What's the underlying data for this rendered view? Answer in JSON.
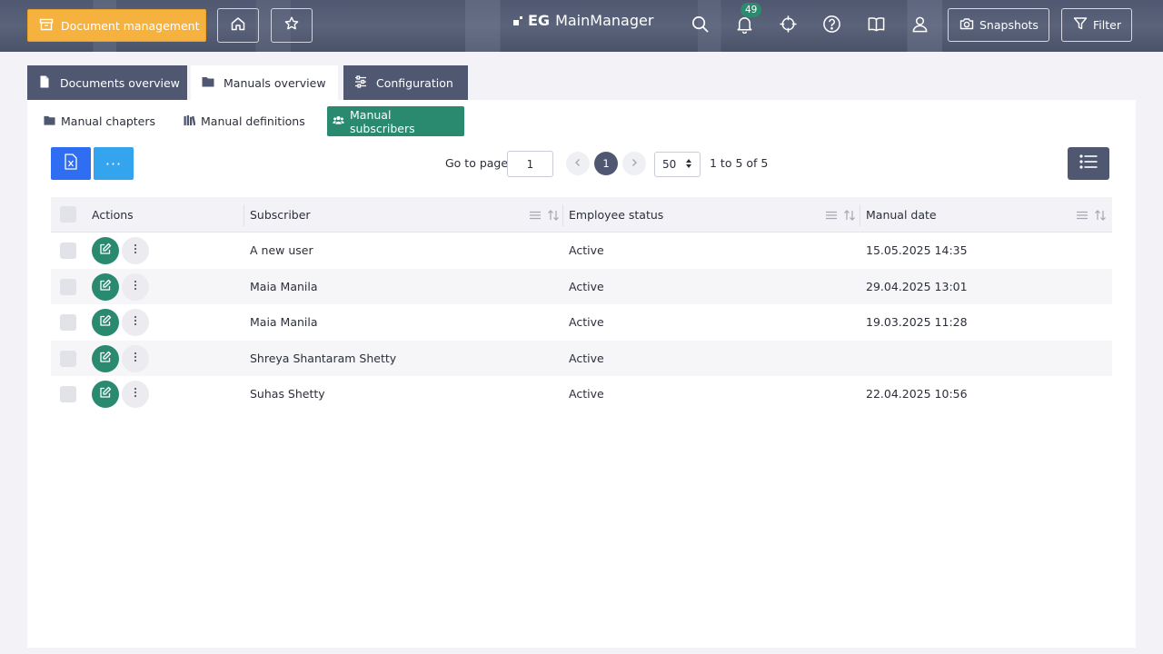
{
  "topbar": {
    "document_management_label": "Document management",
    "logo_bold": "EG",
    "logo_text": "MainManager",
    "notification_count": "49",
    "snapshots_label": "Snapshots",
    "filter_label": "Filter"
  },
  "tabs": [
    {
      "label": "Documents overview"
    },
    {
      "label": "Manuals overview"
    },
    {
      "label": "Configuration"
    }
  ],
  "subtabs": [
    {
      "label": "Manual chapters"
    },
    {
      "label": "Manual definitions"
    },
    {
      "label": "Manual subscribers"
    }
  ],
  "toolbar": {
    "more_label": "···",
    "goto_label": "Go to page",
    "goto_value": "1",
    "current_page": "1",
    "page_size": "50",
    "range_label": "1 to 5 of 5"
  },
  "grid": {
    "columns": [
      "Actions",
      "Subscriber",
      "Employee status",
      "Manual date"
    ],
    "rows": [
      {
        "subscriber": "A new user",
        "status": "Active",
        "date": "15.05.2025 14:35"
      },
      {
        "subscriber": "Maia Manila",
        "status": "Active",
        "date": "29.04.2025 13:01"
      },
      {
        "subscriber": "Maia Manila",
        "status": "Active",
        "date": "19.03.2025 11:28"
      },
      {
        "subscriber": "Shreya Shantaram Shetty",
        "status": "Active",
        "date": ""
      },
      {
        "subscriber": "Suhas Shetty",
        "status": "Active",
        "date": "22.04.2025 10:56"
      }
    ]
  },
  "colors": {
    "accent_orange": "#f6b23f",
    "header_slate": "#4f5870",
    "active_green": "#2a8a70",
    "excel_blue": "#2f6df2",
    "more_blue": "#35a4ee"
  }
}
